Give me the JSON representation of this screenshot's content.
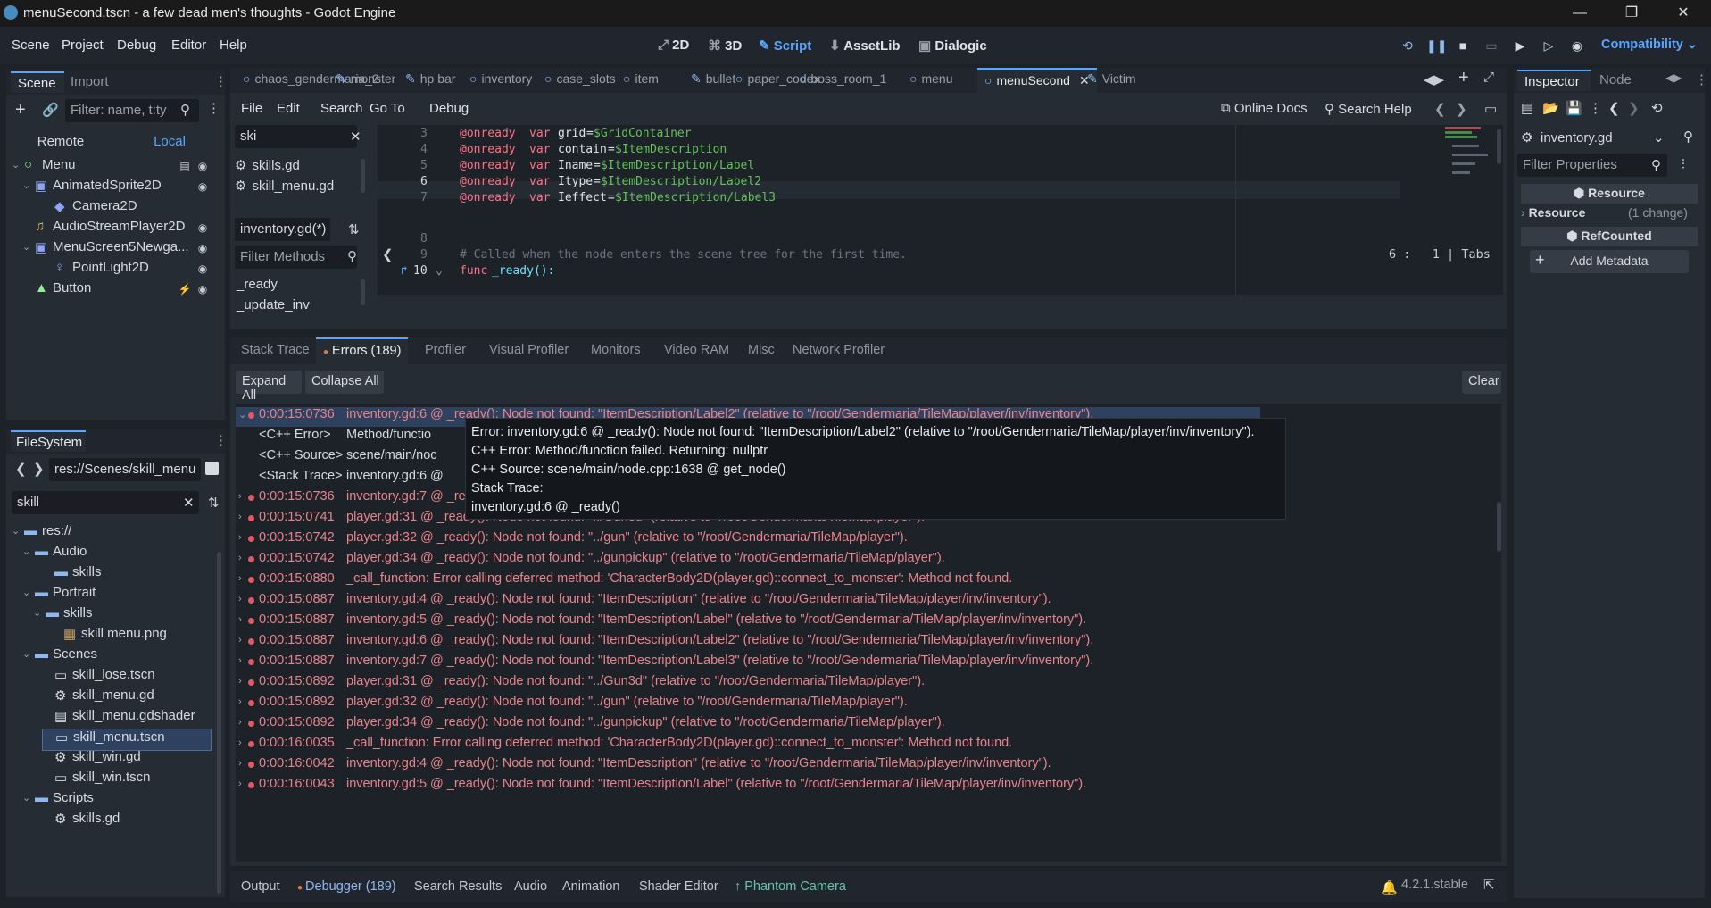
{
  "window": {
    "title": "menuSecond.tscn - a few dead men's thoughts - Godot Engine",
    "controls": [
      "—",
      "❐",
      "✕"
    ]
  },
  "menubar": {
    "items": [
      "Scene",
      "Project",
      "Debug",
      "Editor",
      "Help"
    ],
    "main_screens": [
      "2D",
      "3D",
      "Script",
      "AssetLib",
      "Dialogic"
    ],
    "active_screen": "Script",
    "renderer": "Compatibility"
  },
  "scene_dock": {
    "tabs": [
      "Scene",
      "Import"
    ],
    "filter_placeholder": "Filter: name, t:ty",
    "remote": "Remote",
    "local": "Local",
    "nodes": [
      {
        "label": "Menu",
        "icon": "control-node-icon"
      },
      {
        "label": "AnimatedSprite2D",
        "icon": "animated-sprite-icon"
      },
      {
        "label": "Camera2D",
        "icon": "camera-icon"
      },
      {
        "label": "AudioStreamPlayer2D",
        "icon": "audio-icon"
      },
      {
        "label": "MenuScreen5Newga...",
        "icon": "animated-sprite-icon"
      },
      {
        "label": "PointLight2D",
        "icon": "light-icon"
      },
      {
        "label": "Button",
        "icon": "button-icon"
      }
    ]
  },
  "filesystem": {
    "tab": "FileSystem",
    "path": "res://Scenes/skill_menu",
    "search": "skill",
    "items": [
      {
        "label": "res://",
        "type": "folder"
      },
      {
        "label": "Audio",
        "type": "folder"
      },
      {
        "label": "skills",
        "type": "folder"
      },
      {
        "label": "Portrait",
        "type": "folder"
      },
      {
        "label": "skills",
        "type": "folder"
      },
      {
        "label": "skill menu.png",
        "type": "image"
      },
      {
        "label": "Scenes",
        "type": "folder"
      },
      {
        "label": "skill_lose.tscn",
        "type": "scene"
      },
      {
        "label": "skill_menu.gd",
        "type": "script"
      },
      {
        "label": "skill_menu.gdshader",
        "type": "shader"
      },
      {
        "label": "skill_menu.tscn",
        "type": "scene"
      },
      {
        "label": "skill_win.gd",
        "type": "script"
      },
      {
        "label": "skill_win.tscn",
        "type": "scene"
      },
      {
        "label": "Scripts",
        "type": "folder"
      },
      {
        "label": "skills.gd",
        "type": "script"
      }
    ]
  },
  "script_tabs": [
    "chaos_gendermaria_2",
    "monster",
    "hp bar",
    "inventory",
    "case_slots",
    "item",
    "bullet",
    "paper_codex",
    "boss_room_1",
    "menu",
    "menuSecond",
    "Victim"
  ],
  "script_menu": [
    "File",
    "Edit",
    "Search",
    "Go To",
    "Debug"
  ],
  "online_docs": "Online Docs",
  "search_help": "Search Help",
  "script_list": {
    "filter": "ski",
    "items": [
      "skills.gd",
      "skill_menu.gd"
    ],
    "current": "inventory.gd(*)",
    "filter_methods": "Filter Methods",
    "methods": [
      "_ready",
      "_update_inv"
    ]
  },
  "code_lines": [
    {
      "n": "3",
      "kw": "@onready",
      "kw2": "var",
      "name": "grid",
      "node": "$GridContainer"
    },
    {
      "n": "4",
      "kw": "@onready",
      "kw2": "var",
      "name": "contain",
      "node": "$ItemDescription"
    },
    {
      "n": "5",
      "kw": "@onready",
      "kw2": "var",
      "name": "Iname",
      "node": "$ItemDescription/Label"
    },
    {
      "n": "6",
      "kw": "@onready",
      "kw2": "var",
      "name": "Itype",
      "node": "$ItemDescription/Label2"
    },
    {
      "n": "7",
      "kw": "@onready",
      "kw2": "var",
      "name": "Ieffect",
      "node": "$ItemDescription/Label3"
    }
  ],
  "code_extra": {
    "line8": "8",
    "line9": "9",
    "comment": "# Called when the node enters the scene tree for the first time.",
    "line10": "10",
    "func_kw": "func",
    "func_name": "_ready():"
  },
  "cursor": {
    "line": "6",
    "col": "1",
    "indent": "Tabs"
  },
  "debugger": {
    "tabs": [
      "Stack Trace",
      "Errors (189)",
      "Profiler",
      "Visual Profiler",
      "Monitors",
      "Video RAM",
      "Misc",
      "Network Profiler"
    ],
    "expand_all": "Expand All",
    "collapse_all": "Collapse All",
    "clear": "Clear",
    "expanded_children": [
      {
        "label": "<C++ Error>",
        "value": "Method/functio"
      },
      {
        "label": "<C++ Source>",
        "value": "scene/main/noc"
      },
      {
        "label": "<Stack Trace>",
        "value": "inventory.gd:6 @"
      }
    ],
    "errors": [
      {
        "time": "0:00:15:0736",
        "msg": "inventory.gd:6 @ _ready(): Node not found: \"ItemDescription/Label2\" (relative to \"/root/Gendermaria/TileMap/player/inv/inventory\")."
      },
      {
        "time": "0:00:15:0736",
        "msg": "inventory.gd:7 @ _ready(): Node not found: \"ItemDescription/Label3\" (relative to \"/root/Gendermaria/TileMap/player/inv/inventory\")."
      },
      {
        "time": "0:00:15:0741",
        "msg": "player.gd:31 @ _ready(): Node not found: \"../Gun3d\" (relative to \"/root/Gendermaria/TileMap/player\")."
      },
      {
        "time": "0:00:15:0742",
        "msg": "player.gd:32 @ _ready(): Node not found: \"../gun\" (relative to \"/root/Gendermaria/TileMap/player\")."
      },
      {
        "time": "0:00:15:0742",
        "msg": "player.gd:34 @ _ready(): Node not found: \"../gunpickup\" (relative to \"/root/Gendermaria/TileMap/player\")."
      },
      {
        "time": "0:00:15:0880",
        "msg": "_call_function: Error calling deferred method: 'CharacterBody2D(player.gd)::connect_to_monster': Method not found."
      },
      {
        "time": "0:00:15:0887",
        "msg": "inventory.gd:4 @ _ready(): Node not found: \"ItemDescription\" (relative to \"/root/Gendermaria/TileMap/player/inv/inventory\")."
      },
      {
        "time": "0:00:15:0887",
        "msg": "inventory.gd:5 @ _ready(): Node not found: \"ItemDescription/Label\" (relative to \"/root/Gendermaria/TileMap/player/inv/inventory\")."
      },
      {
        "time": "0:00:15:0887",
        "msg": "inventory.gd:6 @ _ready(): Node not found: \"ItemDescription/Label2\" (relative to \"/root/Gendermaria/TileMap/player/inv/inventory\")."
      },
      {
        "time": "0:00:15:0887",
        "msg": "inventory.gd:7 @ _ready(): Node not found: \"ItemDescription/Label3\" (relative to \"/root/Gendermaria/TileMap/player/inv/inventory\")."
      },
      {
        "time": "0:00:15:0892",
        "msg": "player.gd:31 @ _ready(): Node not found: \"../Gun3d\" (relative to \"/root/Gendermaria/TileMap/player\")."
      },
      {
        "time": "0:00:15:0892",
        "msg": "player.gd:32 @ _ready(): Node not found: \"../gun\" (relative to \"/root/Gendermaria/TileMap/player\")."
      },
      {
        "time": "0:00:15:0892",
        "msg": "player.gd:34 @ _ready(): Node not found: \"../gunpickup\" (relative to \"/root/Gendermaria/TileMap/player\")."
      },
      {
        "time": "0:00:16:0035",
        "msg": "_call_function: Error calling deferred method: 'CharacterBody2D(player.gd)::connect_to_monster': Method not found."
      },
      {
        "time": "0:00:16:0042",
        "msg": "inventory.gd:4 @ _ready(): Node not found: \"ItemDescription\" (relative to \"/root/Gendermaria/TileMap/player/inv/inventory\")."
      },
      {
        "time": "0:00:16:0043",
        "msg": "inventory.gd:5 @ _ready(): Node not found: \"ItemDescription/Label\" (relative to \"/root/Gendermaria/TileMap/player/inv/inventory\")."
      }
    ],
    "tooltip": [
      "Error: inventory.gd:6 @ _ready(): Node not found: \"ItemDescription/Label2\" (relative to \"/root/Gendermaria/TileMap/player/inv/inventory\").",
      "C++ Error: Method/function failed. Returning: nullptr",
      "C++ Source: scene/main/node.cpp:1638 @ get_node()",
      "Stack Trace:",
      "inventory.gd:6 @ _ready()"
    ]
  },
  "bottom_tabs": [
    "Output",
    "Debugger (189)",
    "Search Results",
    "Audio",
    "Animation",
    "Shader Editor",
    "Phantom Camera"
  ],
  "version": "4.2.1.stable",
  "inspector": {
    "tabs": [
      "Inspector",
      "Node"
    ],
    "object": "inventory.gd",
    "filter": "Filter Properties",
    "resource_header": "Resource",
    "resource_label": "Resource",
    "resource_change": "(1 change)",
    "refcounted": "RefCounted",
    "add_metadata": "Add Metadata"
  },
  "colors": {
    "accent": "#58a6ff",
    "error": "#e8838b",
    "bg": "#1d2229"
  }
}
